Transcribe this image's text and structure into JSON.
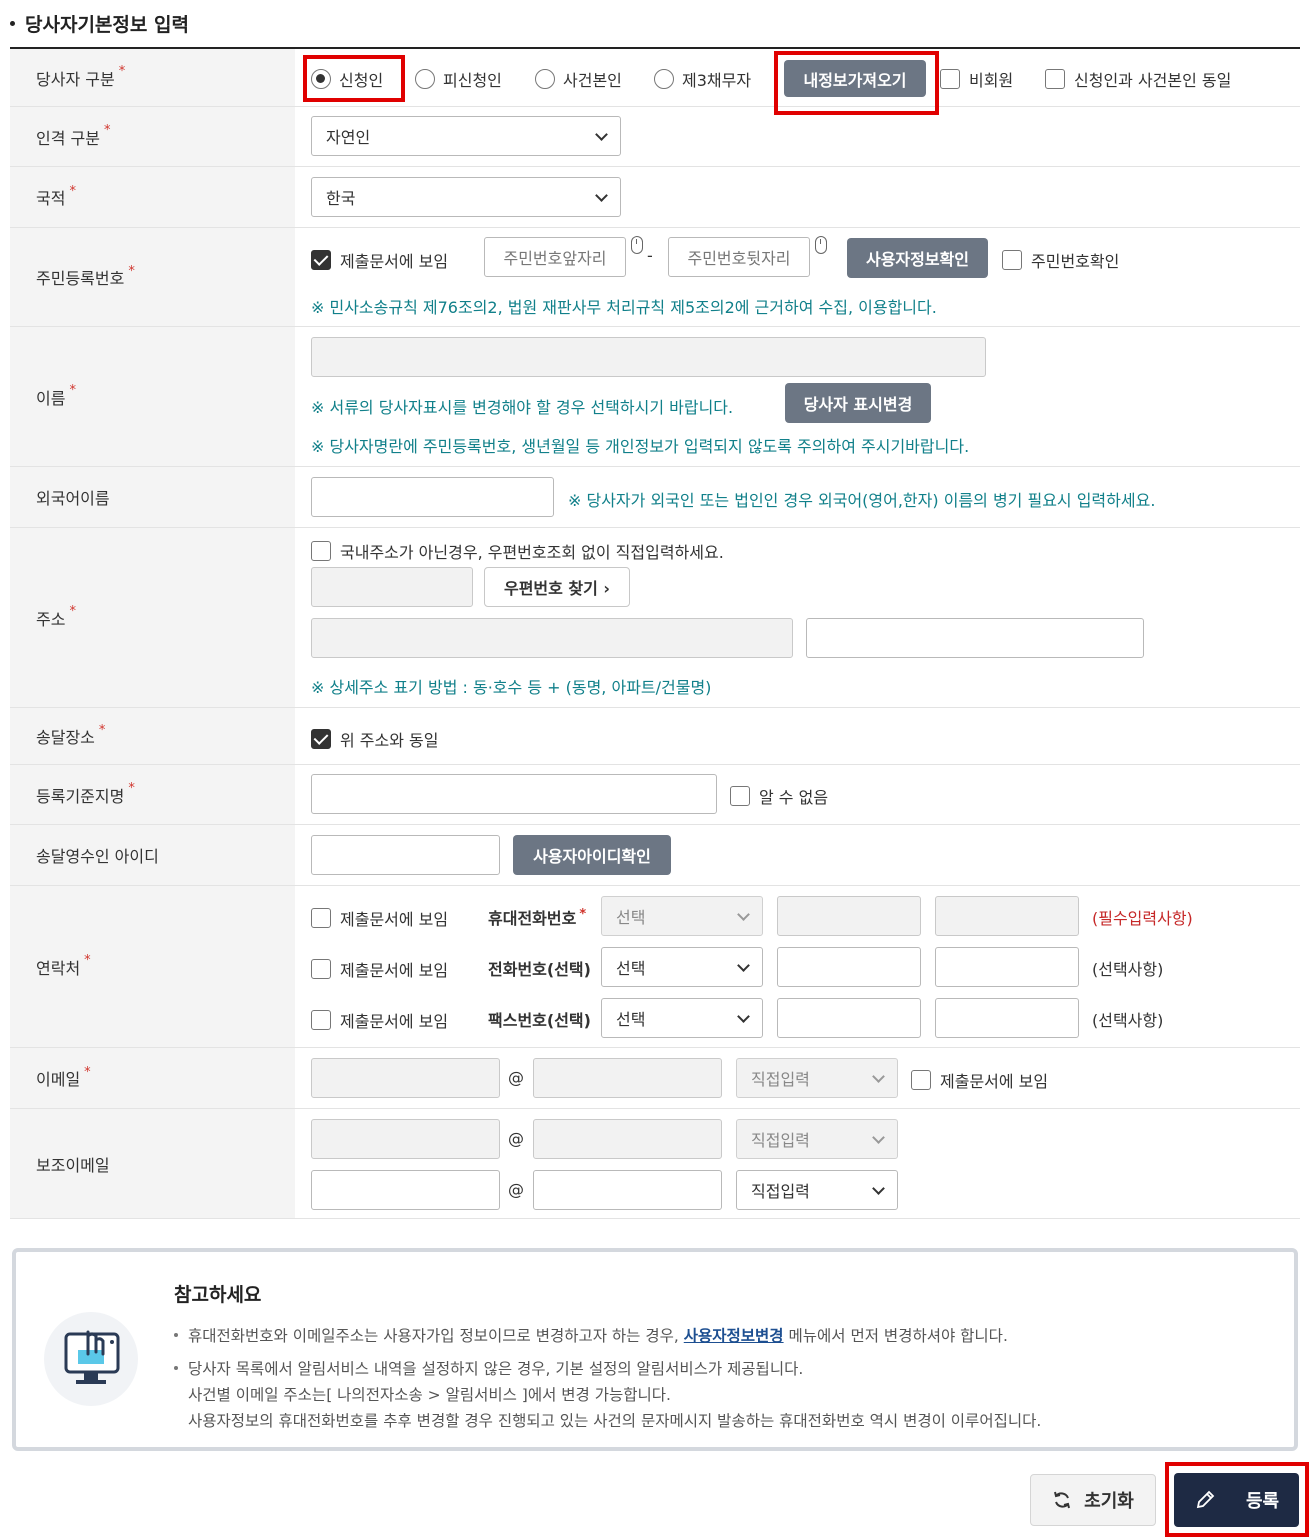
{
  "section": {
    "title": "당사자기본정보 입력"
  },
  "party_type": {
    "label": "당사자 구분",
    "options": [
      "신청인",
      "피신청인",
      "사건본인",
      "제3채무자"
    ],
    "selected": "신청인",
    "load_button": "내정보가져오기",
    "non_member": "비회원",
    "same_as_case_person": "신청인과 사건본인 동일"
  },
  "person_type": {
    "label": "인격 구분",
    "value": "자연인"
  },
  "nationality": {
    "label": "국적",
    "value": "한국"
  },
  "resident_number": {
    "label": "주민등록번호",
    "show_in_doc": "제출문서에 보임",
    "front_placeholder": "주민번호앞자리",
    "dash": "-",
    "back_placeholder": "주민번호뒷자리",
    "check_button": "사용자정보확인",
    "confirm_check": "주민번호확인",
    "note": "※ 민사소송규칙 제76조의2, 법원 재판사무 처리규칙 제5조의2에 근거하여 수집, 이용합니다."
  },
  "name": {
    "label": "이름",
    "note1": "※ 서류의 당사자표시를 변경해야 할 경우 선택하시기 바랍니다.",
    "change_button": "당사자 표시변경",
    "note2": "※ 당사자명란에 주민등록번호, 생년월일 등 개인정보가 입력되지 않도록 주의하여 주시기바랍니다."
  },
  "foreign_name": {
    "label": "외국어이름",
    "note": "※ 당사자가 외국인 또는 법인인 경우 외국어(영어,한자) 이름의 병기 필요시 입력하세요."
  },
  "address": {
    "label": "주소",
    "foreign_check": "국내주소가 아닌경우, 우편번호조회 없이 직접입력하세요.",
    "zip_button": "우편번호 찾기 ›",
    "note": "※ 상세주소 표기 방법 : 동·호수 등 + (동명, 아파트/건물명)"
  },
  "delivery": {
    "label": "송달장소",
    "same_check": "위 주소와 동일"
  },
  "registry_place": {
    "label": "등록기준지명",
    "unknown": "알 수 없음"
  },
  "delivery_id": {
    "label": "송달영수인 아이디",
    "check_button": "사용자아이디확인"
  },
  "contact": {
    "label": "연락처",
    "rows": [
      {
        "show": "제출문서에 보임",
        "name": "휴대전화번호",
        "select": "선택",
        "tag": "(필수입력사항)"
      },
      {
        "show": "제출문서에 보임",
        "name": "전화번호(선택)",
        "select": "선택",
        "tag": "(선택사항)"
      },
      {
        "show": "제출문서에 보임",
        "name": "팩스번호(선택)",
        "select": "선택",
        "tag": "(선택사항)"
      }
    ]
  },
  "email": {
    "label": "이메일",
    "at": "@",
    "domain_select": "직접입력",
    "show_in_doc": "제출문서에 보임"
  },
  "sub_email": {
    "label": "보조이메일",
    "at": "@",
    "domain_select": "직접입력"
  },
  "notice": {
    "title": "참고하세요",
    "line1_pre": "휴대전화번호와 이메일주소는 사용자가입 정보이므로 변경하고자 하는 경우,",
    "line1_link": "사용자정보변경",
    "line1_post": "메뉴에서 먼저 변경하셔야 합니다.",
    "line2": "당사자 목록에서 알림서비스 내역을 설정하지 않은 경우, 기본 설정의 알림서비스가 제공됩니다.",
    "line3": "사건별 이메일 주소는[ 나의전자소송 > 알림서비스 ]에서 변경 가능합니다.",
    "line4": "사용자정보의 휴대전화번호를 추후 변경할 경우 진행되고 있는 사건의 문자메시지 발송하는 휴대전화번호 역시 변경이 이루어집니다."
  },
  "actions": {
    "reset": "초기화",
    "register": "등록"
  },
  "colors": {
    "note_teal": "#11808a",
    "required_red": "#d0342c",
    "highlight_red": "#e00000",
    "dark_button": "#6c7684",
    "register_bg": "#1e2a44"
  }
}
